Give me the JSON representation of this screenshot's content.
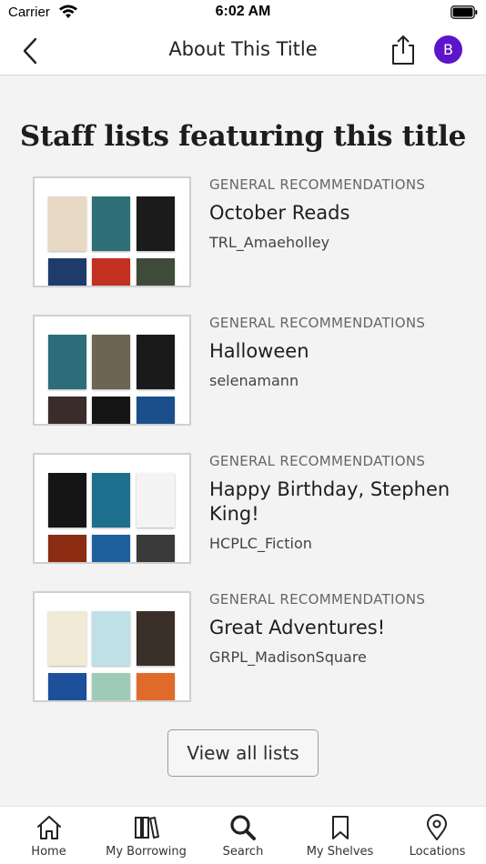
{
  "status_bar": {
    "carrier": "Carrier",
    "time": "6:02 AM"
  },
  "header": {
    "title": "About This Title",
    "back_icon": "chevron-left-icon",
    "share_icon": "share-icon",
    "avatar_initial": "B",
    "avatar_color": "#5c15c9"
  },
  "main": {
    "section_title": "Staff lists featuring this title",
    "lists": [
      {
        "category": "GENERAL RECOMMENDATIONS",
        "title": "October Reads",
        "author": "TRL_Amaeholley",
        "cover_colors": [
          "#e8d9c4",
          "#2f6f78",
          "#1b1b1b",
          "#1f3b6b",
          "#c4301f",
          "#3e4a3a"
        ]
      },
      {
        "category": "GENERAL RECOMMENDATIONS",
        "title": "Halloween",
        "author": "selenamann",
        "cover_colors": [
          "#2c6d7a",
          "#6d6452",
          "#1a1a1a",
          "#3a2c2a",
          "#141414",
          "#1a4f8c"
        ]
      },
      {
        "category": "GENERAL RECOMMENDATIONS",
        "title": "Happy Birthday, Stephen King!",
        "author": "HCPLC_Fiction",
        "cover_colors": [
          "#151515",
          "#1e6e8e",
          "#f4f4f4",
          "#8a2b12",
          "#1e5f9e",
          "#3a3a3a"
        ]
      },
      {
        "category": "GENERAL RECOMMENDATIONS",
        "title": "Great Adventures!",
        "author": "GRPL_MadisonSquare",
        "cover_colors": [
          "#f0ead6",
          "#bfe0e6",
          "#3b2f2a",
          "#1d4f9a",
          "#9ecbb7",
          "#e06a2a"
        ]
      }
    ],
    "view_all_label": "View all lists"
  },
  "tab_bar": {
    "items": [
      {
        "label": "Home",
        "icon": "home-icon"
      },
      {
        "label": "My Borrowing",
        "icon": "books-icon"
      },
      {
        "label": "Search",
        "icon": "search-icon"
      },
      {
        "label": "My Shelves",
        "icon": "bookmark-icon"
      },
      {
        "label": "Locations",
        "icon": "map-pin-icon"
      }
    ]
  }
}
